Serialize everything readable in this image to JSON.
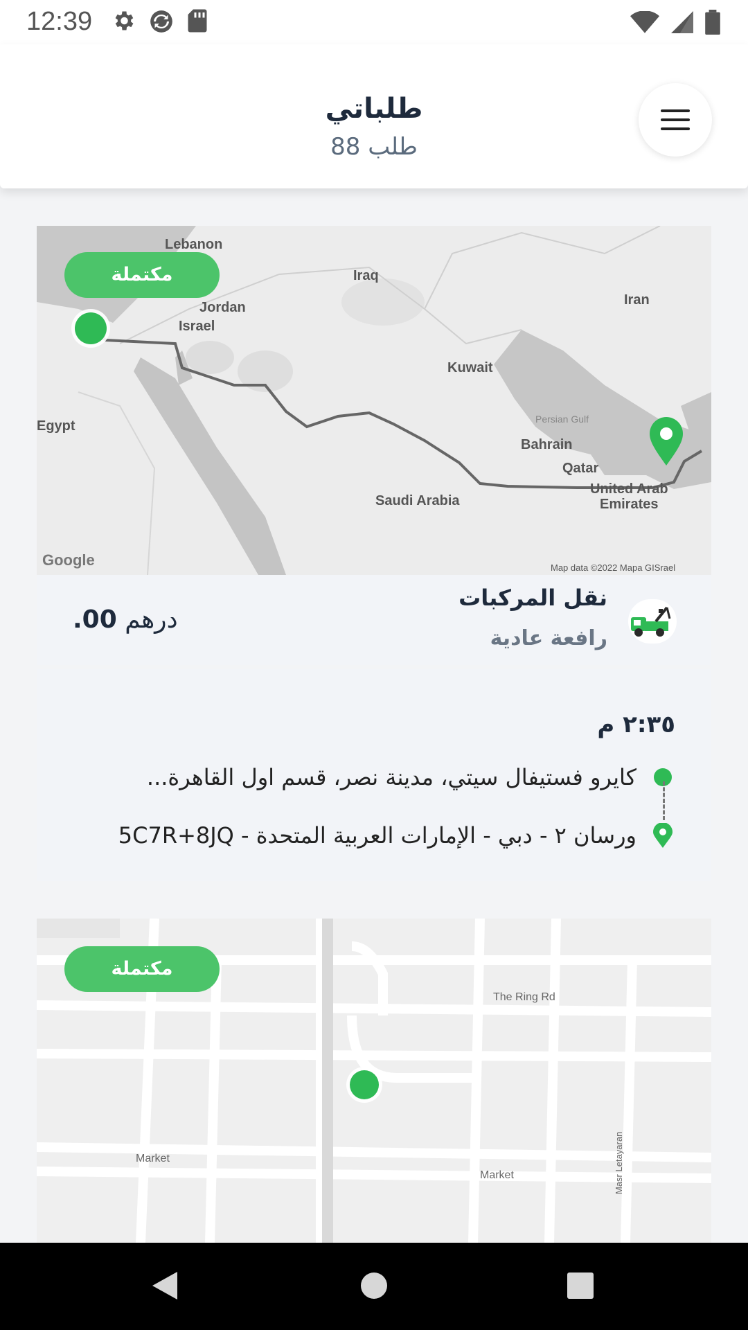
{
  "status": {
    "time": "12:39"
  },
  "header": {
    "title": "طلباتي",
    "subtitle": "88 طلب"
  },
  "orders": [
    {
      "status": "مكتملة",
      "map": {
        "labels": [
          "Lebanon",
          "Iraq",
          "Jordan",
          "Israel",
          "Iran",
          "Kuwait",
          "Egypt",
          "Persian Gulf",
          "Bahrain",
          "Qatar",
          "Saudi Arabia",
          "United Arab",
          "Emirates"
        ],
        "attribution": "Map data ©2022 Mapa GISrael",
        "logo": "Google"
      },
      "service": "نقل المركبات",
      "vehicle_type": "رافعة عادية",
      "price_value": ".00",
      "price_currency": "درهم",
      "time": "٢:٣٥ م",
      "pickup": "كايرو فستيفال سيتي، مدينة نصر، قسم اول القاهرة...",
      "dropoff": "ورسان ٢ - دبي - الإمارات العربية المتحدة - 5C7R+8JQ"
    },
    {
      "status": "مكتملة",
      "map": {
        "labels": [
          "The Ring Rd",
          "Market",
          "Market",
          "Masr Letayaran"
        ]
      }
    }
  ],
  "colors": {
    "accent": "#4cc46a",
    "pin": "#2fba55"
  },
  "icons": [
    "settings-icon",
    "sync-icon",
    "sd-card-icon",
    "wifi-icon",
    "signal-icon",
    "battery-icon",
    "menu-icon",
    "tow-truck-icon",
    "back-icon",
    "home-icon",
    "recents-icon"
  ]
}
